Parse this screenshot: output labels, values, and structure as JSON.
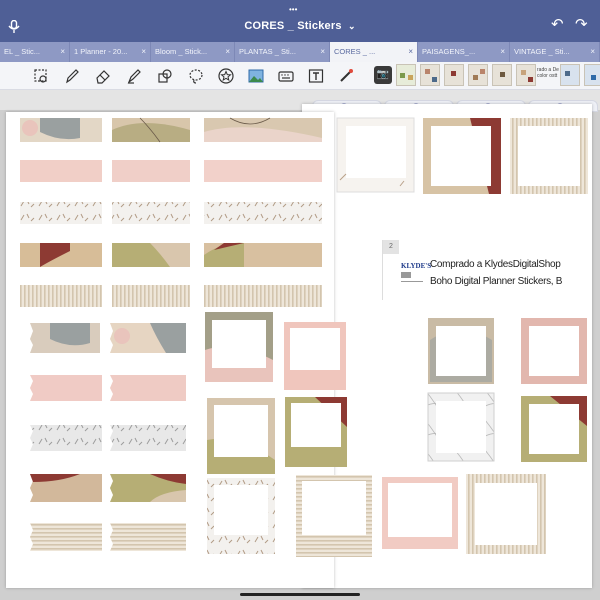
{
  "titlebar": {
    "title": "CORES _ Stickers",
    "chevron": "⌄",
    "mic_icon": "mic-icon",
    "dots": "•••",
    "undo": "↶",
    "redo": "↷"
  },
  "tabs": [
    {
      "label": "EL _ Stic...",
      "active": false
    },
    {
      "label": "1 Planner - 20...",
      "active": false
    },
    {
      "label": "Bloom _ Stick...",
      "active": false
    },
    {
      "label": "PLANTAS _ Sti...",
      "active": false
    },
    {
      "label": "CORES _ ...",
      "active": true
    },
    {
      "label": "PAISAGENS_...",
      "active": false
    },
    {
      "label": "VINTAGE _ Sti...",
      "active": false
    }
  ],
  "tab_close": "×",
  "toolbar": {
    "tools": [
      "lasso-text-icon",
      "pen-icon",
      "eraser-icon",
      "highlighter-icon",
      "shape-icon",
      "lasso-icon",
      "star-sticker-icon",
      "image-icon",
      "keyboard-icon",
      "text-box-icon",
      "laser-pointer-icon"
    ],
    "camera_label": "📷",
    "mini_text": "rado a De color ostt"
  },
  "sticker_label": {
    "number": "2",
    "logo_text": "KLYDE'S",
    "line1": "Comprado a KlydesDigitalShop",
    "line2": "Boho Digital Planner Stickers, B"
  },
  "colors": {
    "accent": "#4f5f96",
    "sage": "#b6ae75",
    "rust": "#8d3a33",
    "blush": "#efc8c2",
    "beige": "#d7c7b0",
    "grey": "#9aa0a0"
  }
}
